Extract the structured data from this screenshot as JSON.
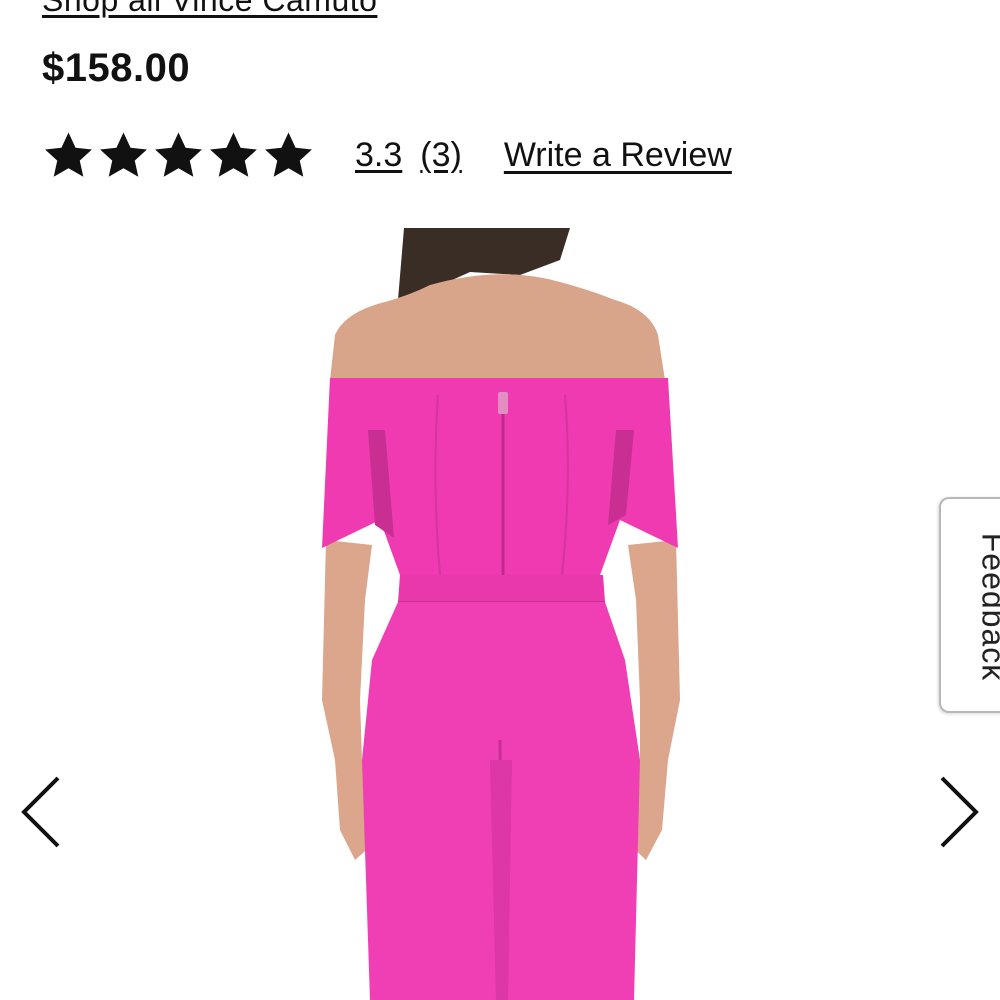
{
  "product": {
    "brand_link": "Shop all Vince Camuto",
    "price": "$158.00",
    "rating": {
      "stars_shown": 5,
      "value": "3.3",
      "count": "(3)",
      "write_review": "Write a Review"
    }
  },
  "gallery": {
    "prev_icon": "chevron-left-icon",
    "next_icon": "chevron-right-icon",
    "garment_color": "#f03fb4"
  },
  "feedback": {
    "label": "Feedback"
  }
}
